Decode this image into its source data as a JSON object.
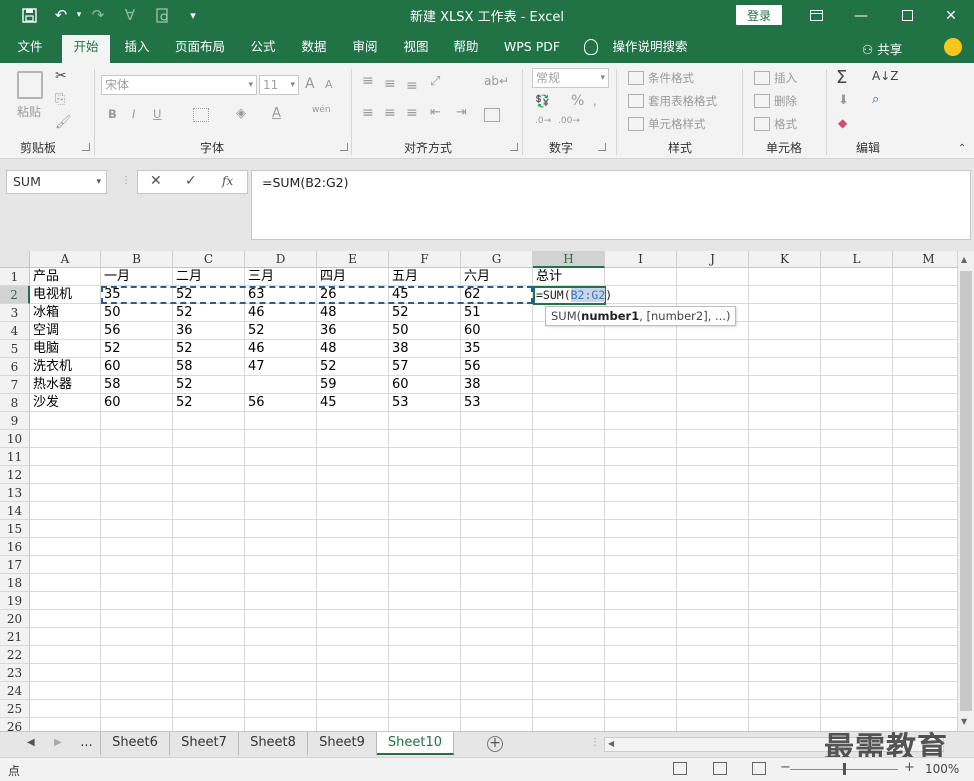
{
  "window": {
    "title": "新建 XLSX 工作表 - Excel",
    "login_label": "登录"
  },
  "ribbon_tabs": [
    {
      "label": "文件"
    },
    {
      "label": "开始"
    },
    {
      "label": "插入"
    },
    {
      "label": "页面布局"
    },
    {
      "label": "公式"
    },
    {
      "label": "数据"
    },
    {
      "label": "审阅"
    },
    {
      "label": "视图"
    },
    {
      "label": "帮助"
    },
    {
      "label": "WPS PDF"
    }
  ],
  "tell_me": "操作说明搜索",
  "share_label": "共享",
  "ribbon": {
    "clipboard": {
      "paste": "粘贴",
      "label": "剪贴板"
    },
    "font": {
      "name": "宋体",
      "size": "11",
      "bold": "B",
      "italic": "I",
      "underline": "U",
      "grow": "A",
      "shrink": "A",
      "font_color": "A",
      "phonetic": "wén",
      "label": "字体"
    },
    "alignment": {
      "label": "对齐方式"
    },
    "number": {
      "format": "常规",
      "percent": "%",
      "label": "数字"
    },
    "styles": {
      "conditional": "条件格式",
      "table": "套用表格格式",
      "cell_styles": "单元格样式",
      "label": "样式"
    },
    "cells": {
      "insert": "插入",
      "delete": "删除",
      "format": "格式",
      "label": "单元格"
    },
    "editing": {
      "label": "编辑"
    }
  },
  "formula_bar": {
    "name_box": "SUM",
    "formula": "=SUM(B2:G2)",
    "fx": "fx"
  },
  "columns": [
    "A",
    "B",
    "C",
    "D",
    "E",
    "F",
    "G",
    "H",
    "I",
    "J",
    "K",
    "L",
    "M"
  ],
  "rows": [
    "1",
    "2",
    "3",
    "4",
    "5",
    "6",
    "7",
    "8",
    "9",
    "10",
    "11",
    "12",
    "13",
    "14",
    "15",
    "16",
    "17",
    "18",
    "19",
    "20",
    "21",
    "22",
    "23",
    "24",
    "25",
    "26"
  ],
  "cells": [
    [
      "产品",
      "一月",
      "二月",
      "三月",
      "四月",
      "五月",
      "六月",
      "总计"
    ],
    [
      "电视机",
      "35",
      "52",
      "63",
      "26",
      "45",
      "62",
      ""
    ],
    [
      "冰箱",
      "50",
      "52",
      "46",
      "48",
      "52",
      "51",
      ""
    ],
    [
      "空调",
      "56",
      "36",
      "52",
      "36",
      "50",
      "60",
      ""
    ],
    [
      "电脑",
      "52",
      "52",
      "46",
      "48",
      "38",
      "35",
      ""
    ],
    [
      "洗衣机",
      "60",
      "58",
      "47",
      "52",
      "57",
      "56",
      ""
    ],
    [
      "热水器",
      "58",
      "52",
      "",
      "59",
      "60",
      "38",
      ""
    ],
    [
      "沙发",
      "60",
      "52",
      "56",
      "45",
      "53",
      "53",
      ""
    ]
  ],
  "edit_cell": {
    "prefix": "=SUM(",
    "ref": "B2:G2",
    "suffix": ")"
  },
  "tooltip": {
    "func": "SUM(",
    "arg1": "number1",
    "rest": ", [number2], ...)"
  },
  "sheets": {
    "ellipsis": "...",
    "tabs": [
      {
        "label": "Sheet6"
      },
      {
        "label": "Sheet7"
      },
      {
        "label": "Sheet8"
      },
      {
        "label": "Sheet9"
      },
      {
        "label": "Sheet10"
      }
    ]
  },
  "status": {
    "mode": "点",
    "zoom": "100%"
  },
  "watermark": "最需教育",
  "colors": {
    "excel_green": "#217346",
    "marquee_blue": "#1f5f9a"
  }
}
